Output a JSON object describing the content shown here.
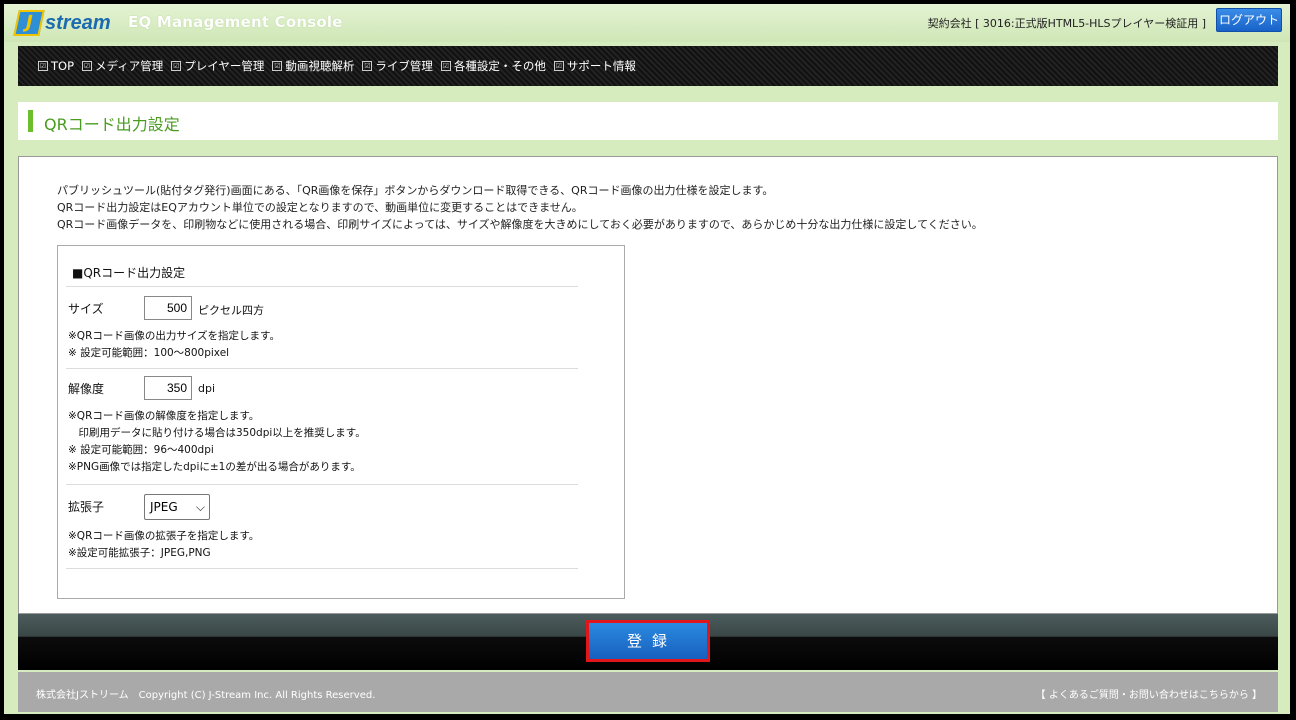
{
  "header": {
    "logo_mark": "J",
    "logo_text": "stream",
    "console_title": "EQ Management Console",
    "contract_label": "契約会社 [ 3016:正式版HTML5-HLSプレイヤー検証用 ]",
    "logout_label": "ログアウト"
  },
  "nav": {
    "items": [
      {
        "label": "TOP"
      },
      {
        "label": "メディア管理"
      },
      {
        "label": "プレイヤー管理"
      },
      {
        "label": "動画視聴解析"
      },
      {
        "label": "ライブ管理"
      },
      {
        "label": "各種設定・その他"
      },
      {
        "label": "サポート情報"
      }
    ]
  },
  "page": {
    "title": "QRコード出力設定"
  },
  "description": {
    "line1": "パブリッシュツール(貼付タグ発行)画面にある、「QR画像を保存」ボタンからダウンロード取得できる、QRコード画像の出力仕様を設定します。",
    "line2": "QRコード出力設定はEQアカウント単位での設定となりますので、動画単位に変更することはできません。",
    "line3": "QRコード画像データを、印刷物などに使用される場合、印刷サイズによっては、サイズや解像度を大きめにしておく必要がありますので、あらかじめ十分な出力仕様に設定してください。"
  },
  "settings": {
    "section_title": "■QRコード出力設定",
    "size": {
      "label": "サイズ",
      "value": "500",
      "unit": "ピクセル四方",
      "note1": "※QRコード画像の出力サイズを指定します。",
      "note2": "※ 設定可能範囲：100～800pixel"
    },
    "resolution": {
      "label": "解像度",
      "value": "350",
      "unit": "dpi",
      "note1": "※QRコード画像の解像度を指定します。",
      "note2": "　印刷用データに貼り付ける場合は350dpi以上を推奨します。",
      "note3": "※ 設定可能範囲：96～400dpi",
      "note4": "※PNG画像では指定したdpiに±1の差が出る場合があります。"
    },
    "extension": {
      "label": "拡張子",
      "selected": "JPEG",
      "note1": "※QRコード画像の拡張子を指定します。",
      "note2": "※設定可能拡張子：JPEG,PNG"
    }
  },
  "actions": {
    "register_label": "登録"
  },
  "footer": {
    "copyright": "株式会社Jストリーム　Copyright (C) J-Stream Inc. All Rights Reserved.",
    "faq_link": "【 よくあるご質問・お問い合わせはこちらから 】"
  }
}
